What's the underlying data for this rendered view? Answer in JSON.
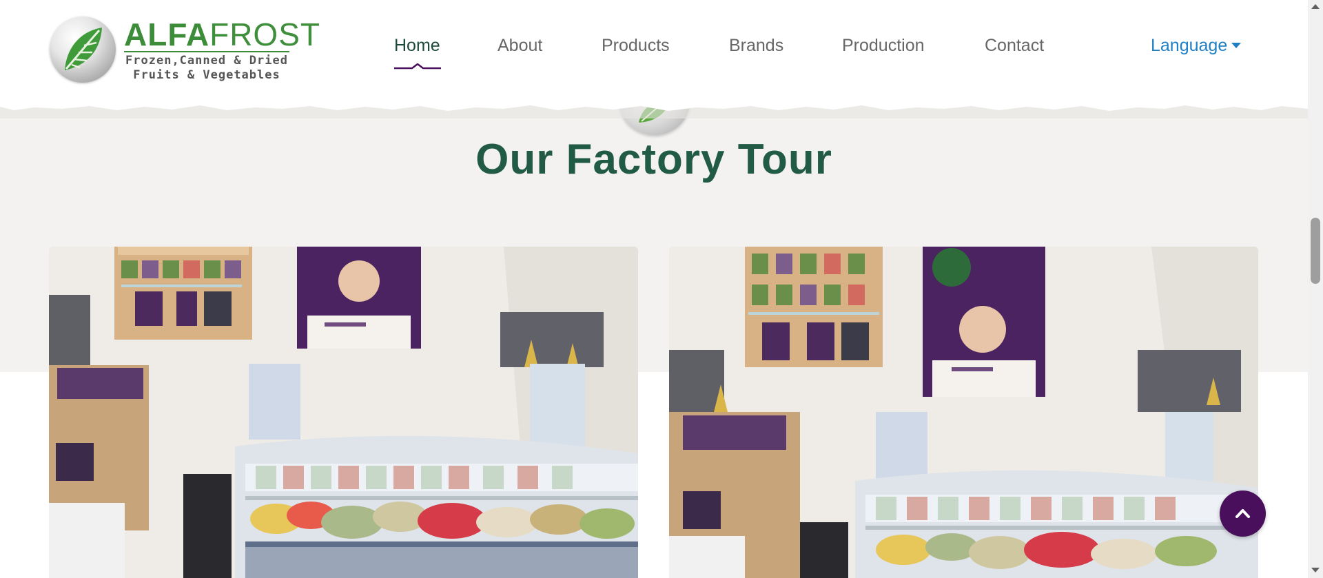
{
  "brand": {
    "name_part1": "ALFA",
    "name_part2": "FROST",
    "tagline_line1": "Frozen,Canned & Dried",
    "tagline_line2": "Fruits & Vegetables",
    "logo_icon": "leaf-emblem-icon"
  },
  "nav": {
    "items": [
      {
        "label": "Home",
        "active": true
      },
      {
        "label": "About",
        "active": false
      },
      {
        "label": "Products",
        "active": false
      },
      {
        "label": "Brands",
        "active": false
      },
      {
        "label": "Production",
        "active": false
      },
      {
        "label": "Contact",
        "active": false
      }
    ],
    "language_label": "Language",
    "language_icon": "caret-down-icon"
  },
  "section": {
    "title": "Our Factory Tour",
    "emblem_icon": "leaf-emblem-icon"
  },
  "gallery": {
    "photos": [
      {
        "alt": "Alfafrost exhibition booth with freezer display"
      },
      {
        "alt": "Alfafrost exhibition booth with poster and freezer display"
      }
    ]
  },
  "back_to_top": {
    "icon": "chevron-up-icon"
  },
  "colors": {
    "brand_green": "#3d8c3a",
    "title_green": "#215a45",
    "nav_active": "#1e4a3c",
    "nav_text": "#666666",
    "link_blue": "#1f7fc4",
    "accent_purple": "#4a0f5c",
    "section_bg": "#f3f2f1"
  }
}
